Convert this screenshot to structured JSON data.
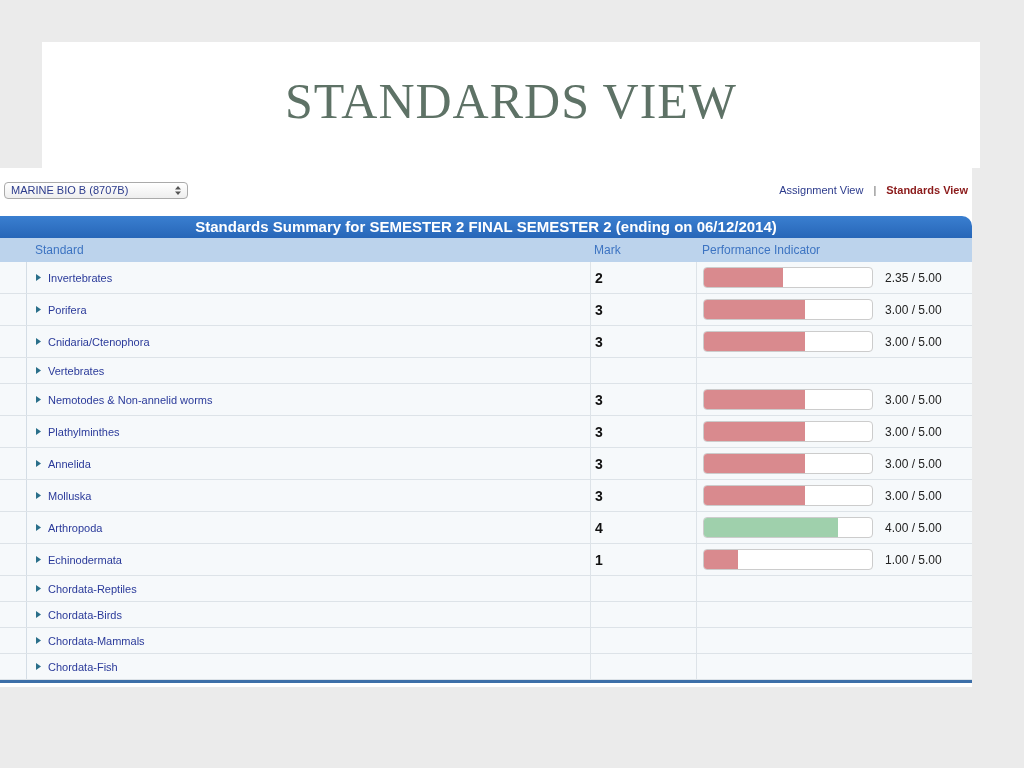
{
  "slide_title": "STANDARDS VIEW",
  "course_select": {
    "value": "MARINE BIO B (8707B)"
  },
  "view_links": [
    {
      "label": "Assignment View",
      "selected": false
    },
    {
      "label": "Standards View",
      "selected": true
    }
  ],
  "view_separator": "|",
  "summary_title": "Standards Summary for SEMESTER 2 FINAL SEMESTER 2 (ending on 06/12/2014)",
  "columns": [
    "Standard",
    "Mark",
    "Performance Indicator"
  ],
  "rows": [
    {
      "standard": "Invertebrates",
      "mark": "2",
      "level": 0.47,
      "reading": "2.35 / 5.00",
      "color": "#d98a8e"
    },
    {
      "standard": "Porifera",
      "mark": "3",
      "level": 0.6,
      "reading": "3.00 / 5.00",
      "color": "#d98a8e"
    },
    {
      "standard": "Cnidaria/Ctenophora",
      "mark": "3",
      "level": 0.6,
      "reading": "3.00 / 5.00",
      "color": "#d98a8e"
    },
    {
      "standard": "Vertebrates"
    },
    {
      "standard": "Nemotodes & Non-annelid worms",
      "mark": "3",
      "level": 0.6,
      "reading": "3.00 / 5.00",
      "color": "#d98a8e"
    },
    {
      "standard": "Plathylminthes",
      "mark": "3",
      "level": 0.6,
      "reading": "3.00 / 5.00",
      "color": "#d98a8e"
    },
    {
      "standard": "Annelida",
      "mark": "3",
      "level": 0.6,
      "reading": "3.00 / 5.00",
      "color": "#d98a8e"
    },
    {
      "standard": "Molluska",
      "mark": "3",
      "level": 0.6,
      "reading": "3.00 / 5.00",
      "color": "#d98a8e"
    },
    {
      "standard": "Arthropoda",
      "mark": "4",
      "level": 0.8,
      "reading": "4.00 / 5.00",
      "color": "#9fd0ac"
    },
    {
      "standard": "Echinodermata",
      "mark": "1",
      "level": 0.2,
      "reading": "1.00 / 5.00",
      "color": "#d98a8e"
    },
    {
      "standard": "Chordata-Reptiles"
    },
    {
      "standard": "Chordata-Birds"
    },
    {
      "standard": "Chordata-Mammals"
    },
    {
      "standard": "Chordata-Fish"
    }
  ]
}
